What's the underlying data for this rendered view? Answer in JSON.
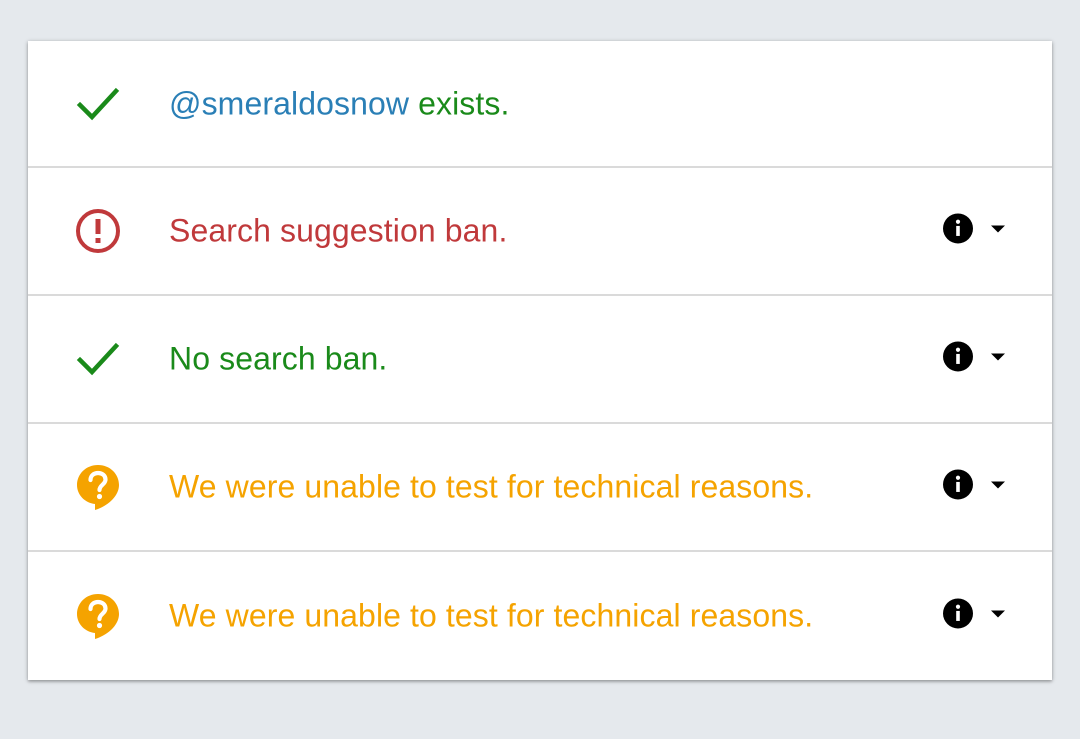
{
  "rows": [
    {
      "status": "ok",
      "icon": "checkmark-icon",
      "handle": "@smeraldosnow",
      "text": " exists.",
      "has_controls": false
    },
    {
      "status": "warn",
      "icon": "alert-circle-icon",
      "text": "Search suggestion ban.",
      "has_controls": true
    },
    {
      "status": "ok",
      "icon": "checkmark-icon",
      "text": "No search ban.",
      "has_controls": true
    },
    {
      "status": "unknown",
      "icon": "question-bubble-icon",
      "text": "We were unable to test for technical reasons.",
      "has_controls": true
    },
    {
      "status": "unknown",
      "icon": "question-bubble-icon",
      "text": "We were unable to test for technical reasons.",
      "has_controls": true
    }
  ],
  "colors": {
    "background": "#e5e9ed",
    "handle": "#2a7fb6",
    "ok": "#1a8a1a",
    "warn": "#c0393b",
    "unknown": "#f5a300",
    "divider": "#dadada"
  }
}
